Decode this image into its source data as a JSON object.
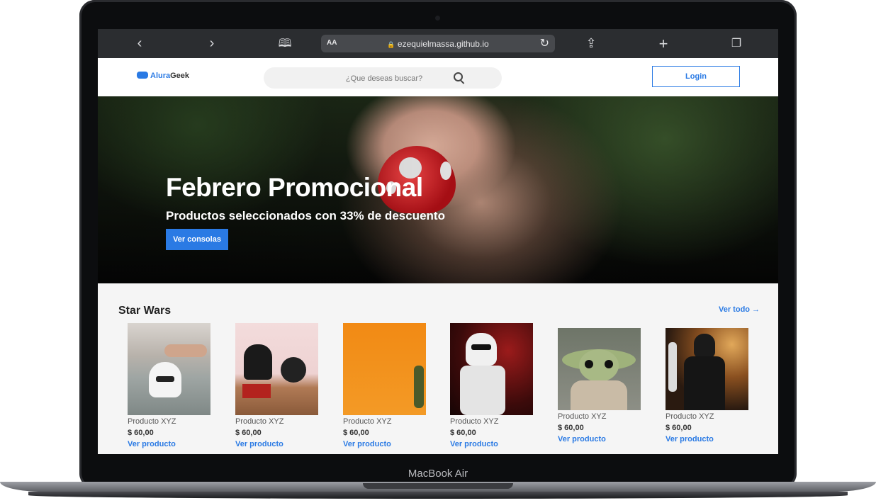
{
  "device": {
    "label": "MacBook Air"
  },
  "browser": {
    "text_size_label": "AA",
    "address": "ezequielmassa.github.io",
    "icons": [
      "chevron-left-icon",
      "chevron-right-icon",
      "book-icon",
      "lock-icon",
      "reload-icon",
      "share-icon",
      "plus-icon",
      "tabs-icon"
    ]
  },
  "header": {
    "logo_prefix": "Alura",
    "logo_suffix": "Geek",
    "search_placeholder": "¿Que deseas buscar?",
    "login_label": "Login"
  },
  "hero": {
    "title": "Febrero Promocional",
    "subtitle": "Productos seleccionados con 33% de descuento",
    "button_label": "Ver consolas"
  },
  "section": {
    "title": "Star Wars",
    "see_all": "Ver todo →",
    "products": [
      {
        "name": "Producto XYZ",
        "price": "$ 60,00",
        "link": "Ver producto"
      },
      {
        "name": "Producto XYZ",
        "price": "$ 60,00",
        "link": "Ver producto"
      },
      {
        "name": "Producto XYZ",
        "price": "$ 60,00",
        "link": "Ver producto"
      },
      {
        "name": "Producto XYZ",
        "price": "$ 60,00",
        "link": "Ver producto"
      },
      {
        "name": "Producto XYZ",
        "price": "$ 60,00",
        "link": "Ver producto"
      },
      {
        "name": "Producto XYZ",
        "price": "$ 60,00",
        "link": "Ver producto"
      }
    ]
  },
  "colors": {
    "accent": "#2a7ae4",
    "section_bg": "#f5f5f5",
    "browser_bar": "#2b2d30"
  }
}
